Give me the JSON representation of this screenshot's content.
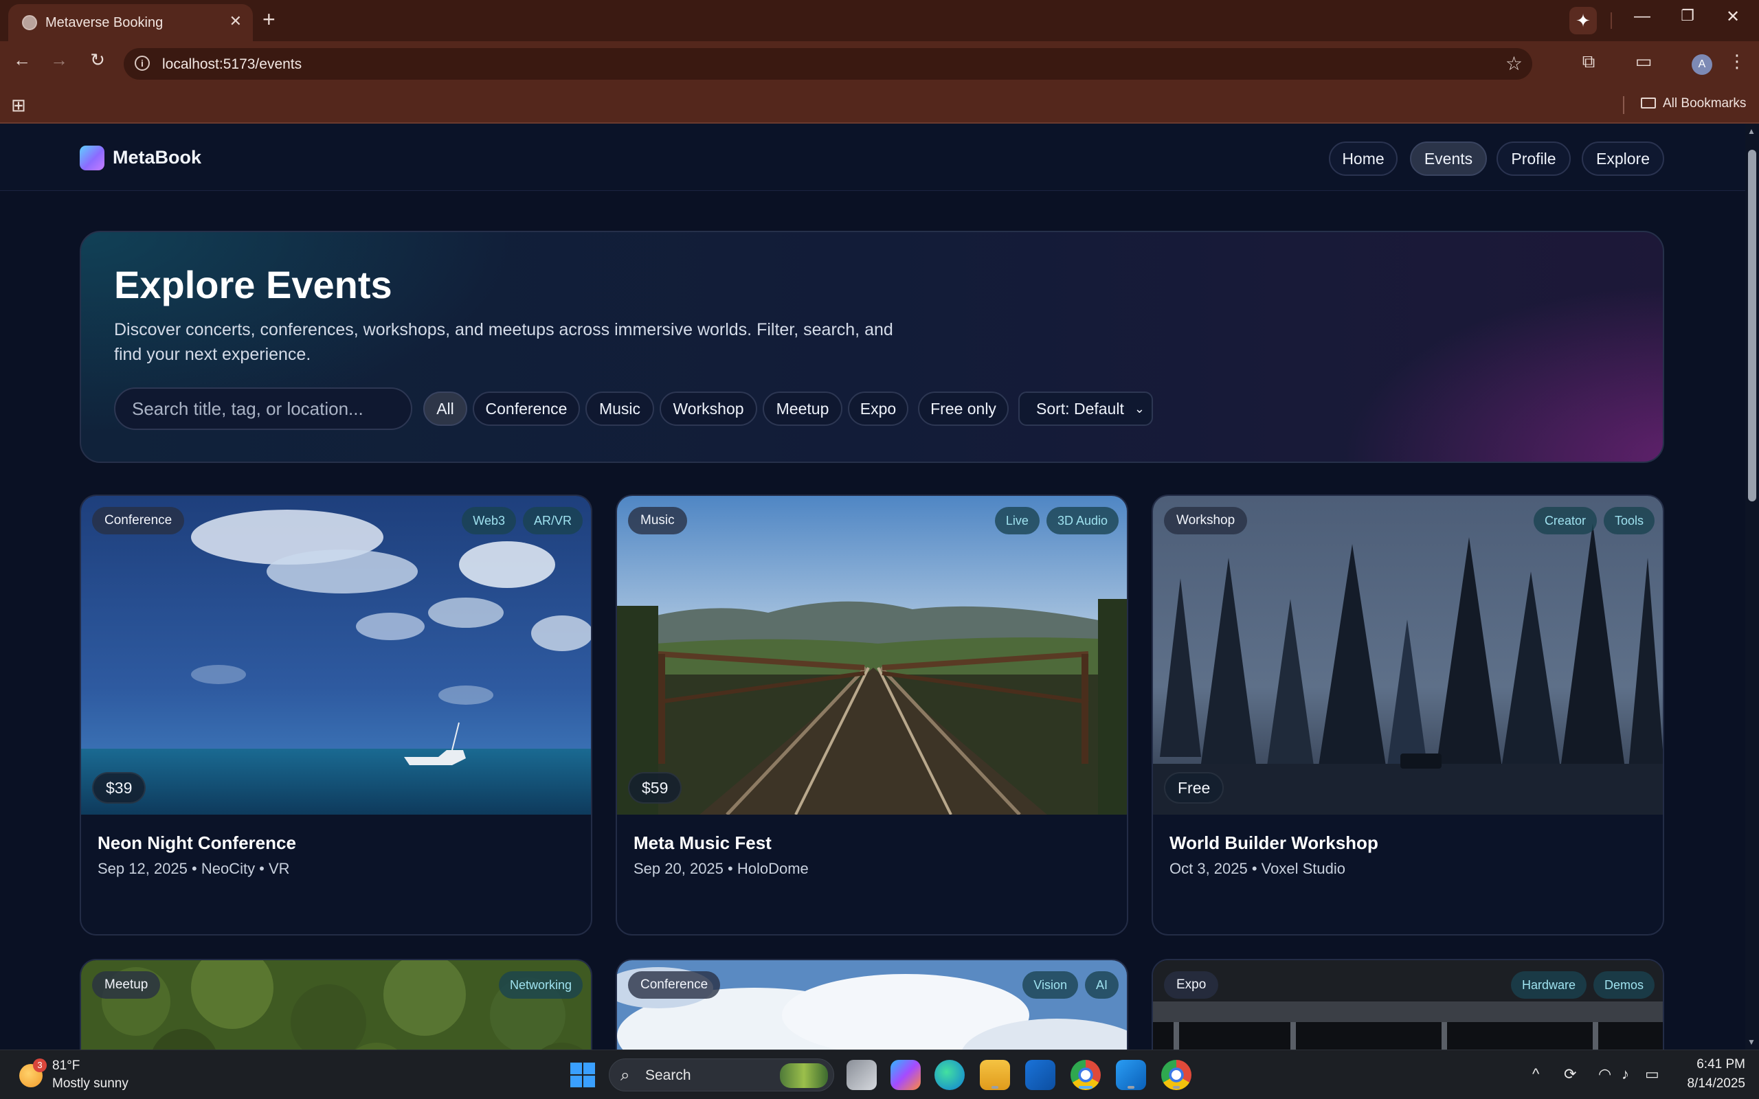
{
  "browser": {
    "tab_title": "Metaverse Booking",
    "url": "localhost:5173/events",
    "bookmarks_label": "All Bookmarks",
    "profile_initial": "A"
  },
  "site": {
    "logo": "MetaBook",
    "nav": [
      "Home",
      "Events",
      "Profile",
      "Explore"
    ],
    "active_nav": "Events"
  },
  "hero": {
    "title": "Explore Events",
    "description": "Discover concerts, conferences, workshops, and meetups across immersive worlds. Filter, search, and find your next experience.",
    "search_placeholder": "Search title, tag, or location...",
    "filters": [
      "All",
      "Conference",
      "Music",
      "Workshop",
      "Meetup",
      "Expo",
      "Free only"
    ],
    "active_filter": "All",
    "sort_label": "Sort: Default"
  },
  "events": [
    {
      "category": "Conference",
      "tags": [
        "Web3",
        "AR/VR"
      ],
      "price": "$39",
      "title": "Neon Night Conference",
      "meta": "Sep 12, 2025 • NeoCity • VR",
      "image": "ocean-sky-boat"
    },
    {
      "category": "Music",
      "tags": [
        "Live",
        "3D Audio"
      ],
      "price": "$59",
      "title": "Meta Music Fest",
      "meta": "Sep 20, 2025 • HoloDome",
      "image": "railway-bridge"
    },
    {
      "category": "Workshop",
      "tags": [
        "Creator",
        "Tools"
      ],
      "price": "Free",
      "title": "World Builder Workshop",
      "meta": "Oct 3, 2025 • Voxel Studio",
      "image": "pine-forest"
    },
    {
      "category": "Meetup",
      "tags": [
        "Networking"
      ],
      "image": "forest-canopy"
    },
    {
      "category": "Conference",
      "tags": [
        "Vision",
        "AI"
      ],
      "image": "clouds"
    },
    {
      "category": "Expo",
      "tags": [
        "Hardware",
        "Demos"
      ],
      "image": "hall-ceiling"
    }
  ],
  "taskbar": {
    "weather_temp": "81°F",
    "weather_desc": "Mostly sunny",
    "weather_badge": "3",
    "search_label": "Search",
    "time": "6:41 PM",
    "date": "8/14/2025"
  },
  "colors": {
    "page_bg": "#0a1124",
    "accent_tag": "#9fe2ef",
    "chrome": "#54271c"
  }
}
